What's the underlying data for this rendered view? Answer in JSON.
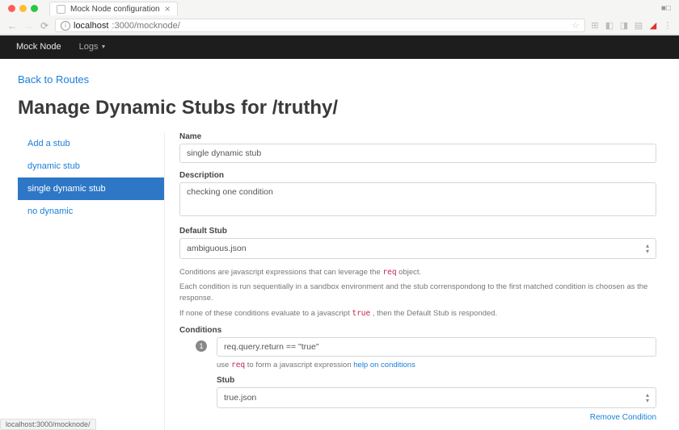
{
  "browser": {
    "tab_title": "Mock Node configuration",
    "url_host": "localhost",
    "url_port_path": ":3000/mocknode/",
    "status_bar": "localhost:3000/mocknode/"
  },
  "navbar": {
    "brand": "Mock Node",
    "logs": "Logs"
  },
  "page": {
    "back": "Back to Routes",
    "title": "Manage Dynamic Stubs for /truthy/"
  },
  "sidebar": {
    "items": [
      {
        "label": "Add a stub",
        "active": false
      },
      {
        "label": "dynamic stub",
        "active": false
      },
      {
        "label": "single dynamic stub",
        "active": true
      },
      {
        "label": "no dynamic",
        "active": false
      }
    ]
  },
  "form": {
    "name_label": "Name",
    "name_value": "single dynamic stub",
    "desc_label": "Description",
    "desc_value": "checking one condition",
    "default_label": "Default Stub",
    "default_value": "ambiguous.json",
    "help1_a": "Conditions are javascript expressions that can leverage the ",
    "help1_req": "req",
    "help1_b": " object.",
    "help2": "Each condition is run sequentially in a sandbox environment and the stub correnspondong to the first matched condition is choosen as the response.",
    "help3_a": "If none of these conditions evaluate to a javascript ",
    "help3_true": "true",
    "help3_b": " , then the Default Stub is responded.",
    "conditions_label": "Conditions",
    "cond_index": "1",
    "cond_expr": "req.query.return == \"true\"",
    "cond_hint_a": "use ",
    "cond_hint_req": "req",
    "cond_hint_b": " to form a javascript expression ",
    "cond_hint_link": "help on conditions",
    "stub_label": "Stub",
    "stub_value": "true.json",
    "remove": "Remove Condition"
  }
}
